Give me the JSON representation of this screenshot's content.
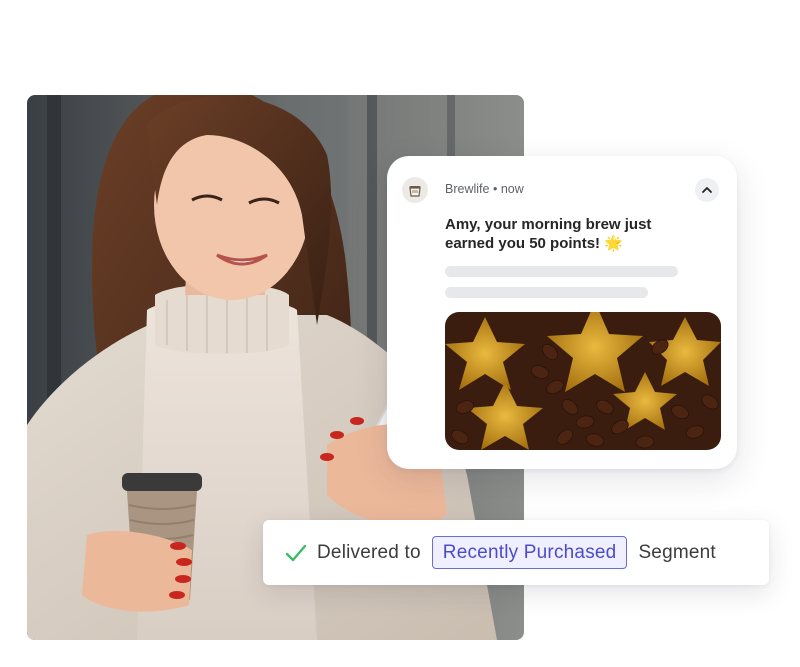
{
  "notification": {
    "app_name": "Brewlife",
    "separator": "•",
    "time": "now",
    "message": "Amy, your morning brew just earned you 50 points! 🌟",
    "app_icon": "coffee-cup-icon",
    "collapse_icon": "chevron-up-icon"
  },
  "delivery": {
    "status_icon": "check-icon",
    "delivered_label": "Delivered to",
    "segment": "Recently Purchased",
    "suffix": "Segment"
  },
  "colors": {
    "check": "#3dbb6a",
    "segment_border": "#6b6bd6",
    "segment_bg": "#efefff",
    "segment_text": "#4c4cc8"
  }
}
